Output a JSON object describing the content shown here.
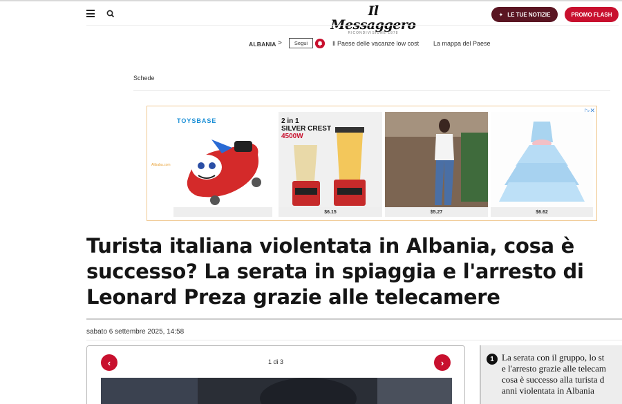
{
  "header": {
    "logo_text": "Il Messaggero",
    "logo_sub": "RICONDIVISIONE 1878",
    "notizie_label": "LE TUE NOTIZIE",
    "promo_label": "PROMO FLASH"
  },
  "subnav": {
    "section": "ALBANIA",
    "chevron": ">",
    "follow_label": "Segui",
    "links": [
      "Il Paese delle vacanze low cost",
      "La mappa del Paese"
    ]
  },
  "schede": "Schede",
  "ad": {
    "brand1": "TOYSBASE",
    "brand_small": "Alibaba.com",
    "promo_line1": "2 in 1",
    "promo_line2": "SILVER CREST",
    "promo_line3": "4500W",
    "prices": [
      "",
      "$6.15",
      "$5.27",
      "$6.62"
    ],
    "choice_icon": "▷✕"
  },
  "article": {
    "headline": "Turista italiana violentata in Albania, cosa è successo? La serata in spiaggia e l'arresto di Leonard Preza grazie alle telecamere",
    "date": "sabato 6 settembre 2025, 14:58"
  },
  "gallery": {
    "counter": "1 di 3",
    "prev": "‹",
    "next": "›"
  },
  "related": {
    "number": "1",
    "lines": [
      "La serata con il gruppo, lo st",
      "e l'arresto grazie alle telecam",
      "cosa è successo alla turista d",
      "anni violentata in Albania"
    ]
  },
  "colors": {
    "brand_red": "#c8102e",
    "notizie_bg": "#5a1522"
  }
}
